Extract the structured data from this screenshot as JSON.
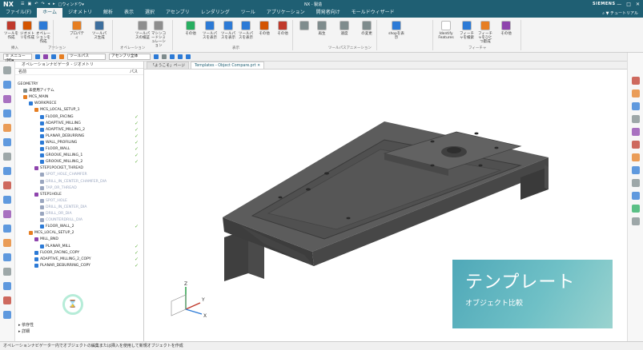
{
  "titlebar": {
    "logo": "NX",
    "quick_access": [
      "☰",
      "▣",
      "↶",
      "↷",
      "◂",
      "▸",
      "□ウィンドウ▾"
    ],
    "window_title": "NX - 製造",
    "brand": "SIEMENS",
    "win_buttons": [
      "—",
      "□",
      "✕"
    ]
  },
  "menubar": {
    "items": [
      "ファイル(F)",
      "ホーム",
      "ジオメトリ",
      "解析",
      "表示",
      "選択",
      "アセンブリ",
      "レンダリング",
      "ツール",
      "アプリケーション",
      "開発者向け",
      "モールドウィザード"
    ],
    "active_index": 1,
    "right_label": "⌕ ▼ チュートリアル"
  },
  "ribbon": {
    "buttons": [
      {
        "label": "ツールを作成",
        "color": "#c0392b"
      },
      {
        "label": "ジオメトリを作成",
        "color": "#d35400"
      },
      {
        "label": "オペレーションを作成",
        "color": "#2c7ad6"
      },
      {
        "label": "プロパティ",
        "color": "#e67e22"
      },
      {
        "label": "ツールパス生成",
        "color": "#3d6f9e"
      },
      {
        "label": "ツールパスの検証",
        "color": "#8e8e8e"
      },
      {
        "label": "マシンコードシミュレーション",
        "color": "#8e8e8e"
      },
      {
        "label": "その他",
        "color": "#27ae60"
      },
      {
        "label": "ツールパスを表示",
        "color": "#2c7ad6"
      },
      {
        "label": "ツールパスを表示",
        "color": "#2c7ad6"
      },
      {
        "label": "ツールパスを表示",
        "color": "#2c7ad6"
      },
      {
        "label": "その他",
        "color": "#d35400"
      },
      {
        "label": "その他",
        "color": "#c0392b"
      },
      {
        "label": "",
        "color": "#7f8c8d"
      },
      {
        "label": "再生",
        "color": "#7f8c8d"
      },
      {
        "label": "速度",
        "color": "#7f8c8d"
      },
      {
        "label": "の変更",
        "color": "#7f8c8d"
      },
      {
        "label": "shopを表示",
        "color": "#2c7ad6"
      },
      {
        "label": "Identify Features",
        "color": "#ffffff"
      },
      {
        "label": "フィーチャを検索",
        "color": "#2c7ad6"
      },
      {
        "label": "フィーチャをひとつ歋成",
        "color": "#e67e22"
      },
      {
        "label": "その他",
        "color": "#8e44ad"
      }
    ],
    "group_labels": [
      "挿入",
      "アクション",
      "オペレーション",
      "表示",
      "ツールパスアニメーション",
      "フィーチャ"
    ]
  },
  "toolbar2": {
    "menu_label": "≡ メニュー(M)▾",
    "filter_value": "ツールパス",
    "assembly_value": "アセンブリ全体"
  },
  "nav": {
    "title": "オペレーションナビゲータ - ジオメトリ",
    "col_name": "名前",
    "col_path": "パス",
    "rows": [
      {
        "text": "GEOMETRY",
        "indent": 0,
        "icon": "",
        "dim": false,
        "check": false
      },
      {
        "text": "未使用アイテム",
        "indent": 1,
        "icon": "#7f8c8d",
        "dim": false,
        "check": false
      },
      {
        "text": "MCS_MAIN",
        "indent": 1,
        "icon": "#e67e22",
        "dim": false,
        "check": false
      },
      {
        "text": "WORKPIECE",
        "indent": 2,
        "icon": "#2c7ad6",
        "dim": false,
        "check": false
      },
      {
        "text": "MCS_LOCAL_SETUP_1",
        "indent": 3,
        "icon": "#e67e22",
        "dim": false,
        "check": false
      },
      {
        "text": "FLOOR_FACING",
        "indent": 4,
        "icon": "#2c7ad6",
        "dim": false,
        "check": true
      },
      {
        "text": "ADAPTIVE_MILLING",
        "indent": 4,
        "icon": "#2c7ad6",
        "dim": false,
        "check": true
      },
      {
        "text": "ADAPTIVE_MILLING_2",
        "indent": 4,
        "icon": "#2c7ad6",
        "dim": false,
        "check": true
      },
      {
        "text": "PLANAR_DEBURRING",
        "indent": 4,
        "icon": "#2c7ad6",
        "dim": false,
        "check": true
      },
      {
        "text": "WALL_PROFILING",
        "indent": 4,
        "icon": "#2c7ad6",
        "dim": false,
        "check": true
      },
      {
        "text": "FLOOR_WALL",
        "indent": 4,
        "icon": "#2c7ad6",
        "dim": false,
        "check": true
      },
      {
        "text": "GROOVE_MILLING_1",
        "indent": 4,
        "icon": "#2c7ad6",
        "dim": false,
        "check": true
      },
      {
        "text": "GROOVE_MILLING_2",
        "indent": 4,
        "icon": "#2c7ad6",
        "dim": false,
        "check": true
      },
      {
        "text": "STEP1POCKET_THREAD",
        "indent": 3,
        "icon": "#8e44ad",
        "dim": false,
        "check": false
      },
      {
        "text": "SPOT_HOLE_CHAMFER",
        "indent": 4,
        "icon": "#9aa6bf",
        "dim": true,
        "check": false
      },
      {
        "text": "DRILL_IN_CENTER_CHAMFER_DIA",
        "indent": 4,
        "icon": "#9aa6bf",
        "dim": true,
        "check": false
      },
      {
        "text": "TAP_OR_THREAD",
        "indent": 4,
        "icon": "#9aa6bf",
        "dim": true,
        "check": false
      },
      {
        "text": "STEP1HOLE",
        "indent": 3,
        "icon": "#8e44ad",
        "dim": false,
        "check": false
      },
      {
        "text": "SPOT_HOLE",
        "indent": 4,
        "icon": "#9aa6bf",
        "dim": true,
        "check": false
      },
      {
        "text": "DRILL_IN_CENTER_DIA",
        "indent": 4,
        "icon": "#9aa6bf",
        "dim": true,
        "check": false
      },
      {
        "text": "DRILL_OR_DIA",
        "indent": 4,
        "icon": "#9aa6bf",
        "dim": true,
        "check": false
      },
      {
        "text": "COUNTERDRILL_DIA",
        "indent": 4,
        "icon": "#9aa6bf",
        "dim": true,
        "check": false
      },
      {
        "text": "FLOOR_WALL_2",
        "indent": 4,
        "icon": "#2c7ad6",
        "dim": false,
        "check": true
      },
      {
        "text": "MCS_LOCAL_SETUP_2",
        "indent": 2,
        "icon": "#e67e22",
        "dim": false,
        "check": false
      },
      {
        "text": "MILL_BND",
        "indent": 3,
        "icon": "#8e44ad",
        "dim": false,
        "check": false
      },
      {
        "text": "PLANAR_MILL",
        "indent": 4,
        "icon": "#2c7ad6",
        "dim": false,
        "check": true
      },
      {
        "text": "FLOOR_FACING_COPY",
        "indent": 3,
        "icon": "#2c7ad6",
        "dim": false,
        "check": true
      },
      {
        "text": "ADAPTIVE_MILLING_2_COPY",
        "indent": 3,
        "icon": "#2c7ad6",
        "dim": false,
        "check": true
      },
      {
        "text": "PLANAR_DEBURRING_COPY",
        "indent": 3,
        "icon": "#2c7ad6",
        "dim": false,
        "check": true
      }
    ],
    "bottom_items": [
      "▸ 依存性",
      "▸ 詳細"
    ]
  },
  "tabs": [
    {
      "label": "「ようこそ」ページ",
      "active": false
    },
    {
      "label": "Templates - Object Compare.prt ✕",
      "active": true
    }
  ],
  "banner": {
    "title": "テンプレート",
    "subtitle": "オブジェクト比較"
  },
  "statusbar": {
    "text": "オペレーションナビゲーター内でオブジェクトの編集または挿入を使用して新規オブジェクトを作成"
  },
  "triad": {
    "x": "X",
    "y": "Y",
    "z": "Z"
  },
  "colors": {
    "brand": "#1f5f73",
    "check": "#5fae3d",
    "banner": "#4fa8b8",
    "part": "#5a5a5a"
  }
}
